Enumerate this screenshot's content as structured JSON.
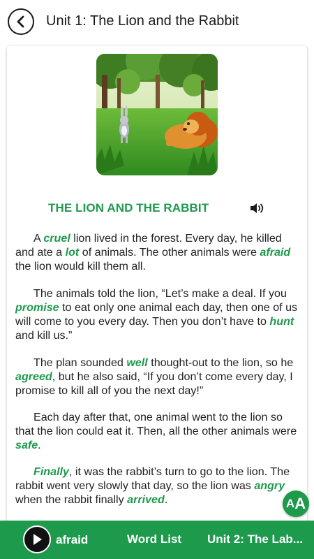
{
  "header": {
    "title": "Unit 1: The Lion and the Rabbit",
    "back_icon": "back-arrow-icon"
  },
  "story": {
    "title": "THE LION AND THE RABBIT",
    "speaker_icon": "speaker-icon",
    "image": "lion-and-rabbit-illustration",
    "accent_color": "#1d9a4c",
    "paragraphs": [
      [
        {
          "t": "A "
        },
        {
          "t": "cruel",
          "kw": true
        },
        {
          "t": " lion lived in the forest. Every day, he killed and ate a "
        },
        {
          "t": "lot",
          "kw": true
        },
        {
          "t": " of animals. The other animals were "
        },
        {
          "t": "afraid",
          "kw": true
        },
        {
          "t": " the lion would kill them all."
        }
      ],
      [
        {
          "t": "The animals told the lion, “Let’s make a deal. If you "
        },
        {
          "t": "promise",
          "kw": true
        },
        {
          "t": " to eat only one animal each day, then one of us will come to you every day. Then you don’t have to "
        },
        {
          "t": "hunt",
          "kw": true
        },
        {
          "t": " and kill us.”"
        }
      ],
      [
        {
          "t": "The plan sounded "
        },
        {
          "t": "well",
          "kw": true
        },
        {
          "t": " thought-out to the lion, so he "
        },
        {
          "t": "agreed",
          "kw": true
        },
        {
          "t": ", but he also said, “If you don’t come every day, I promise to kill all of you the next day!”"
        }
      ],
      [
        {
          "t": "Each day after that, one animal went to the lion so that the lion could eat it. Then, all the other animals were "
        },
        {
          "t": "safe",
          "kw": true
        },
        {
          "t": "."
        }
      ],
      [
        {
          "t": "Finally",
          "kw": true
        },
        {
          "t": ", it was the rabbit’s turn to go to the lion. The rabbit went very slowly that day, so the lion was "
        },
        {
          "t": "angry",
          "kw": true
        },
        {
          "t": " when the rabbit finally "
        },
        {
          "t": "arrived",
          "kw": true
        },
        {
          "t": "."
        }
      ]
    ]
  },
  "font_size_button": {
    "label_small": "A",
    "label_large": "A"
  },
  "footer": {
    "play_icon": "play-icon",
    "current_word": "afraid",
    "word_list_label": "Word List",
    "next_unit_label": "Unit 2: The Lab..."
  }
}
